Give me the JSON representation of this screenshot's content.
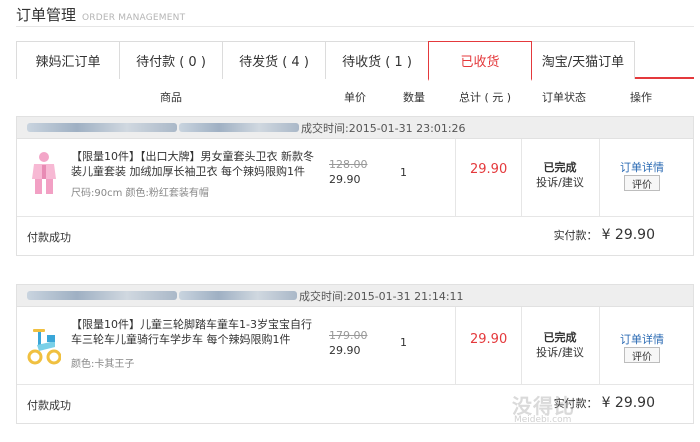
{
  "header": {
    "title": "订单管理",
    "subtitle": "ORDER MANAGEMENT"
  },
  "tabs": [
    {
      "label": "辣妈汇订单",
      "active": false
    },
    {
      "label": "待付款 ( 0 )",
      "active": false
    },
    {
      "label": "待发货 ( 4 )",
      "active": false
    },
    {
      "label": "待收货 ( 1 )",
      "active": false
    },
    {
      "label": "已收货",
      "active": true
    },
    {
      "label": "淘宝/天猫订单",
      "active": false
    }
  ],
  "columns": {
    "product": "商品",
    "unit_price": "单价",
    "quantity": "数量",
    "total": "总计 ( 元 )",
    "status": "订单状态",
    "action": "操作"
  },
  "orders": [
    {
      "deal_time": "成交时间:2015-01-31 23:01:26",
      "name": "【限量10件】【出口大牌】男女童套头卫衣 新款冬装儿童套装 加绒加厚长袖卫衣 每个辣妈限购1件",
      "attrs": "尺码:90cm 颜色:粉红套装有帽",
      "original_price": "128.00",
      "price": "29.90",
      "quantity": "1",
      "total": "29.90",
      "status": "已完成",
      "complaint": "投诉/建议",
      "detail_link": "订单详情",
      "eval_button": "评价",
      "payment_status": "付款成功",
      "actual_label": "实付款：",
      "actual_amount": "¥ 29.90"
    },
    {
      "deal_time": "成交时间:2015-01-31 21:14:11",
      "name": "【限量10件】儿童三轮脚踏车童车1-3岁宝宝自行车三轮车儿童骑行车学步车 每个辣妈限购1件",
      "attrs": "颜色:卡其王子",
      "original_price": "179.00",
      "price": "29.90",
      "quantity": "1",
      "total": "29.90",
      "status": "已完成",
      "complaint": "投诉/建议",
      "detail_link": "订单详情",
      "eval_button": "评价",
      "payment_status": "付款成功",
      "actual_label": "实付款：",
      "actual_amount": "¥ 29.90"
    }
  ],
  "watermark": {
    "text": "没得比",
    "site": "Meidebi.com"
  },
  "colors": {
    "accent": "#e4393c",
    "link": "#2a6ab3",
    "border": "#e1e1e1",
    "header_bg": "#eeeeee"
  }
}
